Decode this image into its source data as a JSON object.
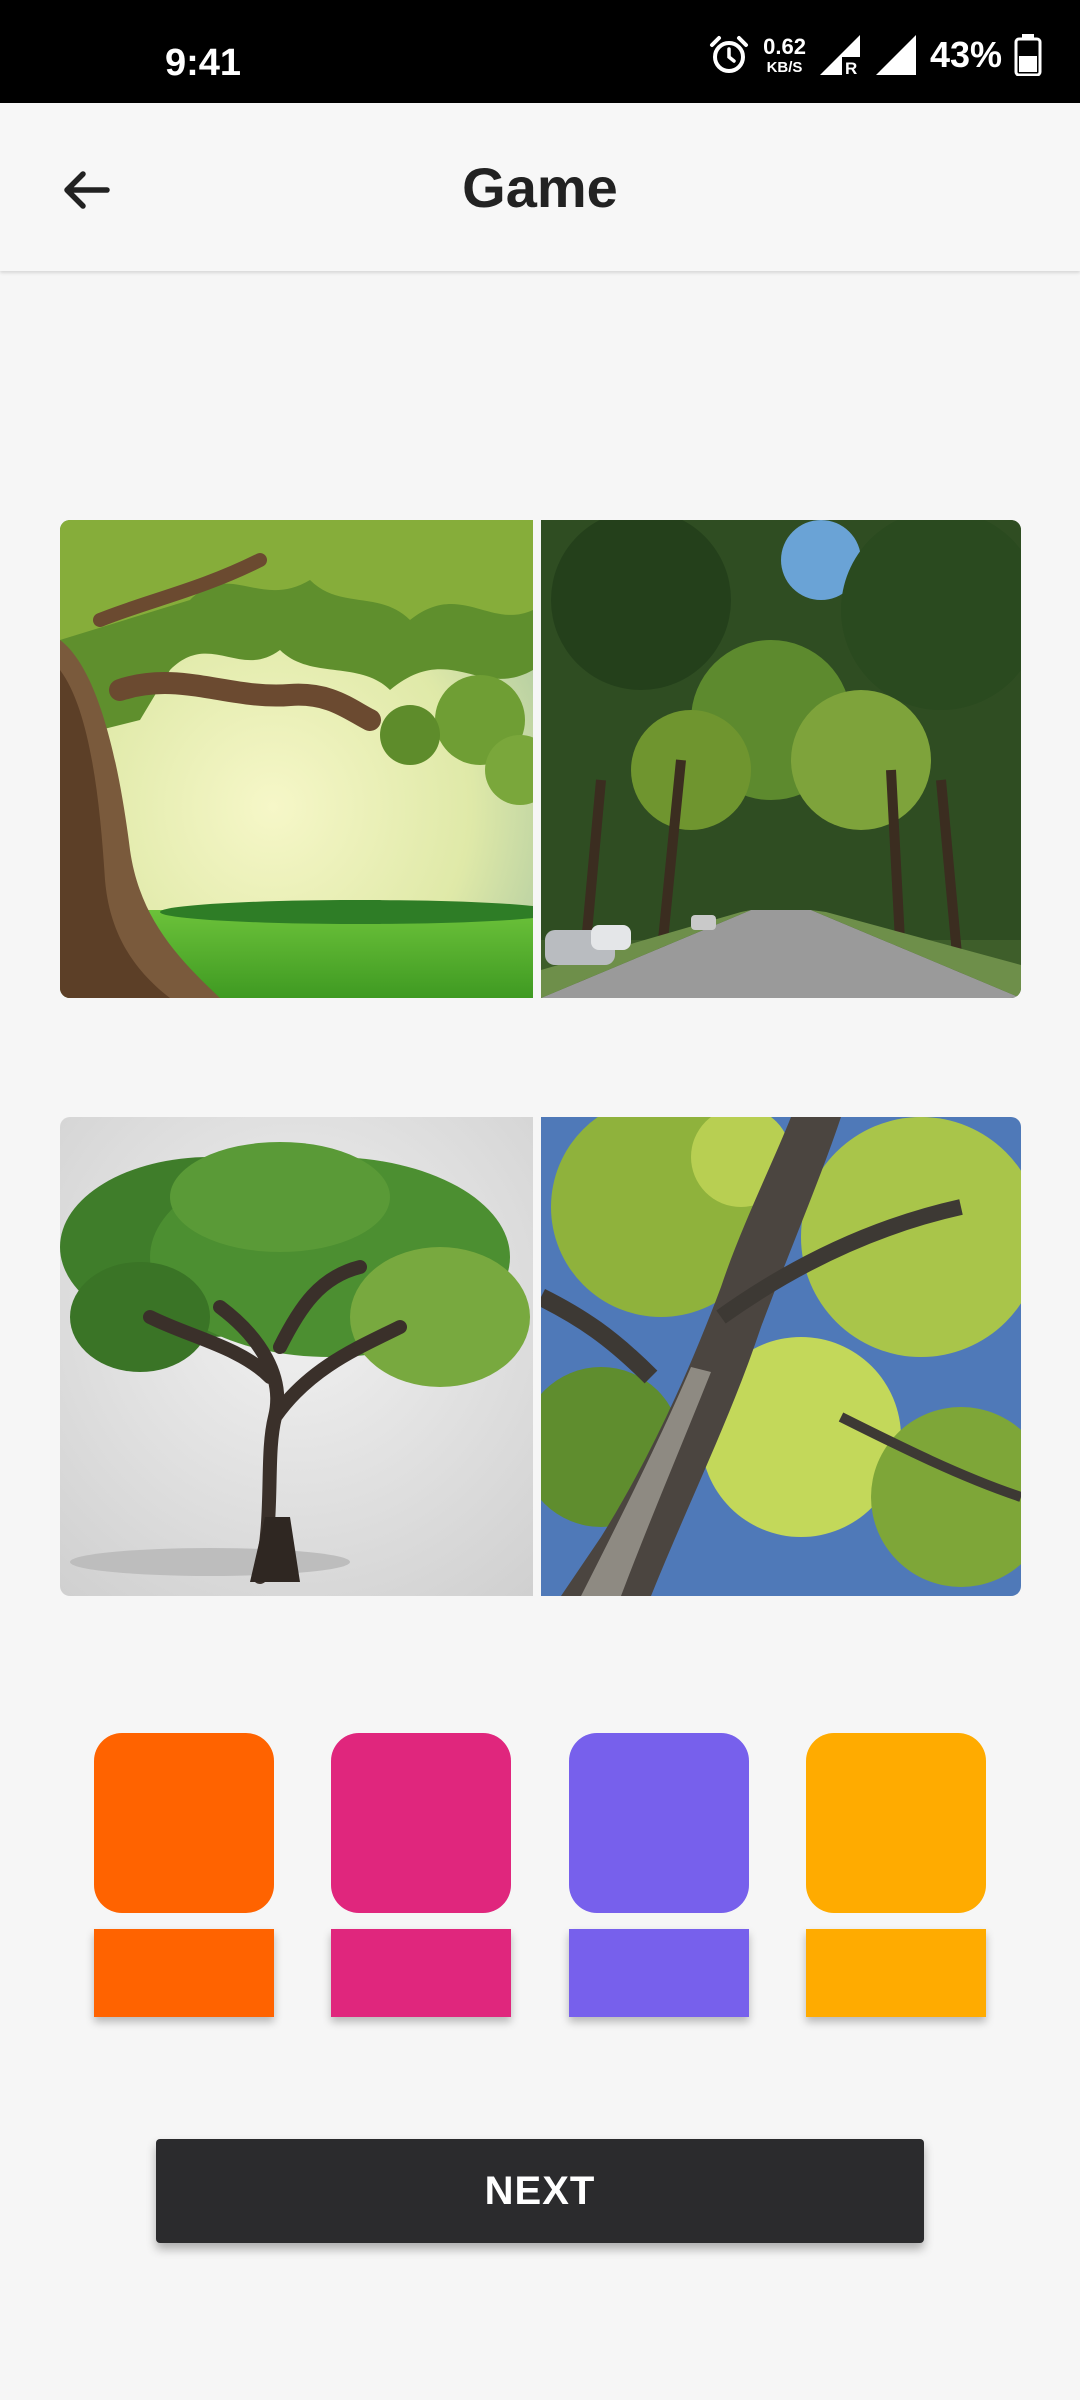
{
  "status_bar": {
    "time": "9:41",
    "net_speed_value": "0.62",
    "net_speed_unit": "KB/S",
    "battery": "43%"
  },
  "app_bar": {
    "title": "Game",
    "back_icon": "arrow-left-icon"
  },
  "photos": [
    {
      "subject": "tree-with-meadow-photo"
    },
    {
      "subject": "tree-lined-street-photo"
    },
    {
      "subject": "single-tree-photo"
    },
    {
      "subject": "tree-canopy-from-below-photo"
    }
  ],
  "color_keys": [
    {
      "color": "#ff6300"
    },
    {
      "color": "#e0267d"
    },
    {
      "color": "#7760ec"
    },
    {
      "color": "#ffab00"
    }
  ],
  "next_button": {
    "label": "NEXT"
  }
}
